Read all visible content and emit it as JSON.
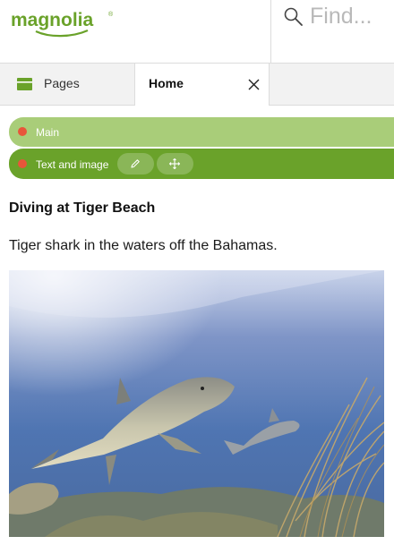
{
  "header": {
    "logo_text": "magnolia",
    "search_placeholder": "Find..."
  },
  "tabs": {
    "pages_label": "Pages",
    "home_label": "Home"
  },
  "editor": {
    "area_label": "Main",
    "component_label": "Text and image"
  },
  "content": {
    "heading": "Diving at Tiger Beach",
    "text": "Tiger shark in the waters off the Bahamas."
  },
  "colors": {
    "brand_green": "#6aa22a",
    "area_bar": "#a9cd79",
    "marker": "#e8553a"
  },
  "icons": [
    "search-icon",
    "pages-icon",
    "close-icon",
    "pencil-icon",
    "move-icon"
  ]
}
